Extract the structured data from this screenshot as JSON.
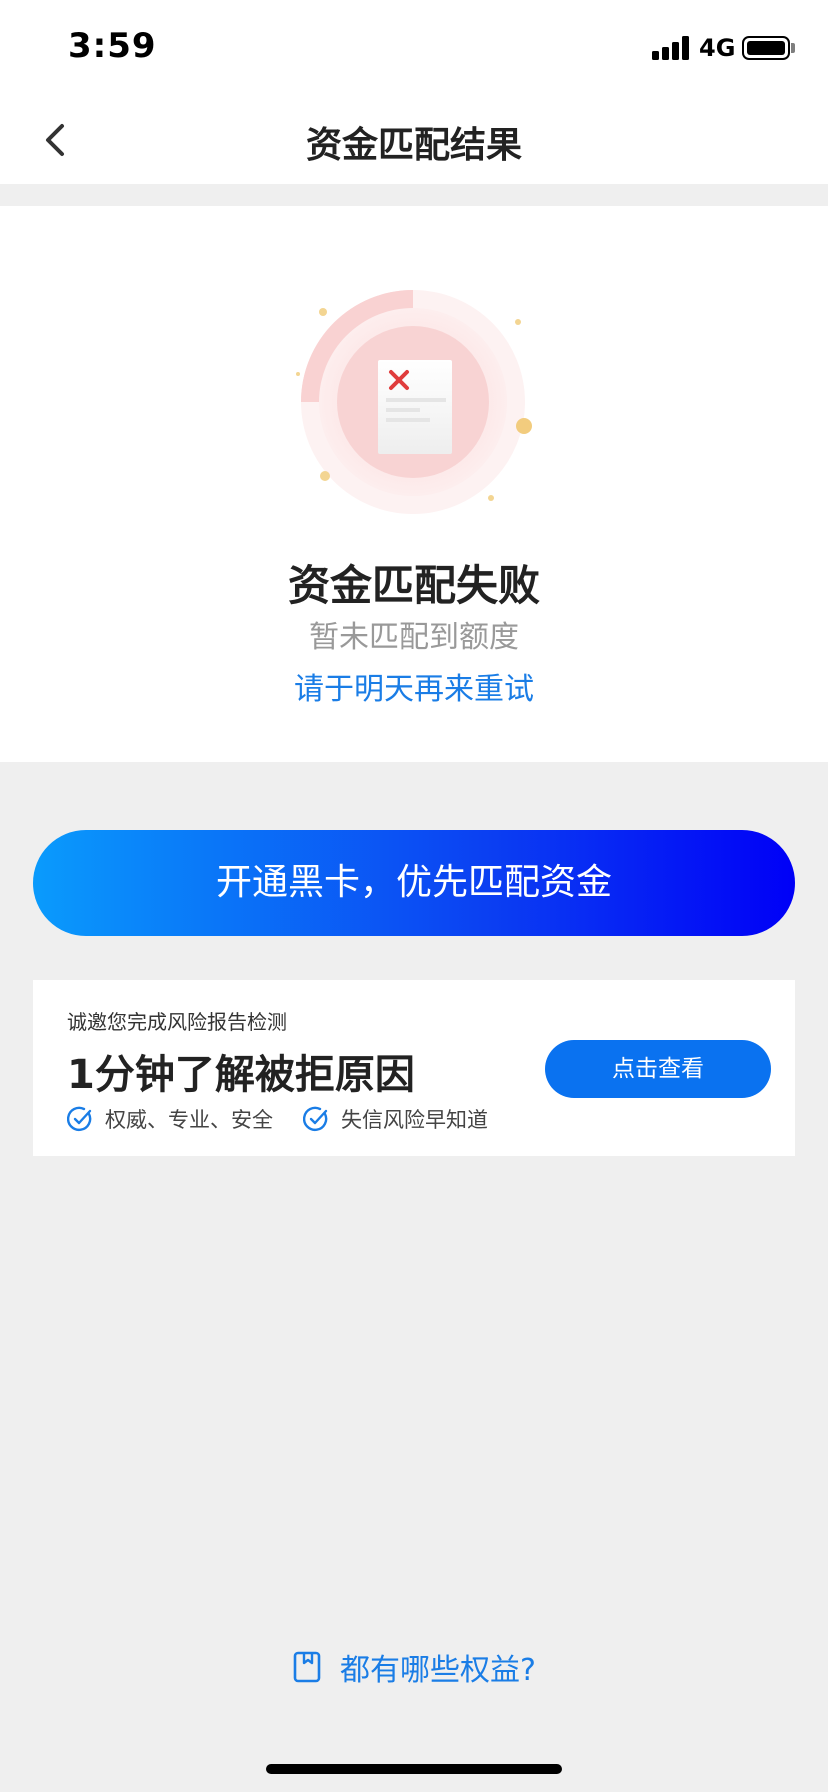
{
  "status_bar": {
    "time": "3:59",
    "network": "4G"
  },
  "nav": {
    "title": "资金匹配结果"
  },
  "result": {
    "title": "资金匹配失败",
    "subtitle": "暂未匹配到额度",
    "hint": "请于明天再来重试"
  },
  "cta": {
    "label": "开通黑卡，优先匹配资金"
  },
  "report": {
    "invite": "诚邀您完成风险报告检测",
    "headline": "1分钟了解被拒原因",
    "features": [
      "权威、专业、安全",
      "失信风险早知道"
    ],
    "button_label": "点击查看"
  },
  "benefits": {
    "label": "都有哪些权益?"
  },
  "colors": {
    "accent": "#1a7de6",
    "button_blue": "#0a72f0",
    "gradient_start": "#0a9bfc",
    "gradient_end": "#0000f7"
  },
  "icons": [
    "back-icon",
    "signal-icon",
    "battery-icon",
    "failed-document-icon",
    "check-icon",
    "book-icon"
  ]
}
